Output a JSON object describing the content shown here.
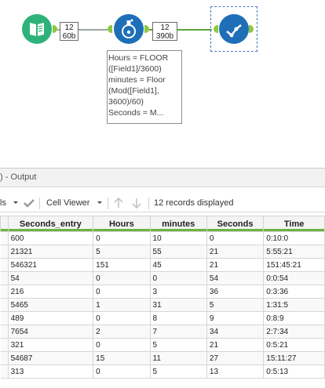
{
  "workflow": {
    "input_count": {
      "records": "12",
      "size": "60b"
    },
    "formula_count": {
      "records": "12",
      "size": "390b"
    },
    "annotation": "Hours = FLOOR\n([Field1]/3600)\nminutes = Floor\n(Mod([Field1],\n3600)/60)\nSeconds = M...",
    "colors": {
      "input_tool": "#2db37a",
      "formula_tool": "#1e6fb8",
      "browse_tool": "#1e6fb8",
      "anchor": "#8dc63f"
    }
  },
  "output": {
    "title": ") - Output",
    "toolbar": {
      "left_partial": "ls",
      "cell_viewer": "Cell Viewer",
      "records_displayed": "12 records displayed"
    },
    "columns": [
      "Seconds_entry",
      "Hours",
      "minutes",
      "Seconds",
      "Time"
    ],
    "rows": [
      [
        "600",
        "0",
        "10",
        "0",
        "0:10:0"
      ],
      [
        "21321",
        "5",
        "55",
        "21",
        "5:55:21"
      ],
      [
        "546321",
        "151",
        "45",
        "21",
        "151:45:21"
      ],
      [
        "54",
        "0",
        "0",
        "54",
        "0:0:54"
      ],
      [
        "216",
        "0",
        "3",
        "36",
        "0:3:36"
      ],
      [
        "5465",
        "1",
        "31",
        "5",
        "1:31:5"
      ],
      [
        "489",
        "0",
        "8",
        "9",
        "0:8:9"
      ],
      [
        "7654",
        "2",
        "7",
        "34",
        "2:7:34"
      ],
      [
        "321",
        "0",
        "5",
        "21",
        "0:5:21"
      ],
      [
        "54687",
        "15",
        "11",
        "27",
        "15:11:27"
      ],
      [
        "313",
        "0",
        "5",
        "13",
        "0:5:13"
      ]
    ]
  }
}
